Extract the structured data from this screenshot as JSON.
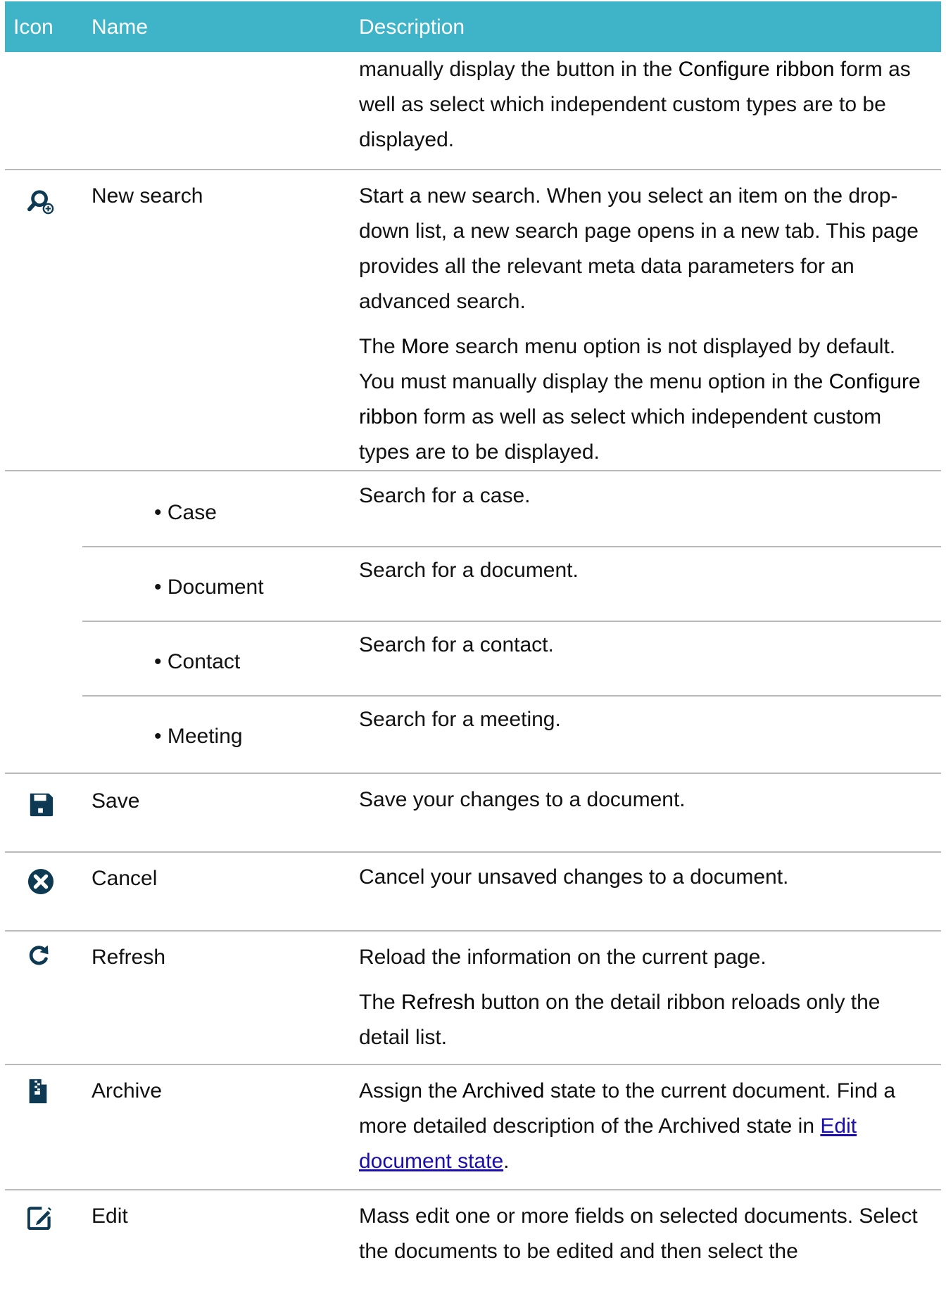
{
  "header": {
    "icon": "Icon",
    "name": "Name",
    "description": "Description"
  },
  "row0": {
    "desc_prefix": "manually display the button in the ",
    "desc_bold": "Configure ribbon",
    "desc_suffix": " form as well as select which independent custom types are to be displayed."
  },
  "new_search": {
    "icon": "search-plus-icon",
    "name": "New search",
    "desc1": "Start a new search. When you select an item on the drop-down list, a new search page opens in a new tab. This page provides all the relevant meta data parameters for an advanced search.",
    "desc2_a": "The ",
    "desc2_b": "More",
    "desc2_c": " search menu option is not displayed by default. You must manually display the menu option in the ",
    "desc2_d": "Configure ribbon",
    "desc2_e": " form as well as select which independent custom types are to be displayed."
  },
  "sub_items": [
    {
      "name": "Case",
      "desc": "Search for a case."
    },
    {
      "name": "Document",
      "desc": "Search for a document."
    },
    {
      "name": "Contact",
      "desc": "Search for a contact."
    },
    {
      "name": "Meeting",
      "desc": "Search for a meeting."
    }
  ],
  "save": {
    "icon": "floppy-disk-icon",
    "name": "Save",
    "desc": "Save your changes to a document."
  },
  "cancel": {
    "icon": "close-circle-icon",
    "name": "Cancel",
    "desc": "Cancel your unsaved changes to a document."
  },
  "refresh": {
    "icon": "refresh-icon",
    "name": "Refresh",
    "desc1": "Reload the information on the current page.",
    "desc2_a": "The ",
    "desc2_b": "Refresh",
    "desc2_c": " button on the detail ribbon reloads only the detail list."
  },
  "archive": {
    "icon": "archive-file-icon",
    "name": "Archive",
    "desc_a": "Assign the ",
    "desc_b": "Archived",
    "desc_c": " state to the current document. Find a more detailed description of the Archived state in ",
    "desc_link": "Edit document state",
    "desc_d": "."
  },
  "edit": {
    "icon": "edit-icon",
    "name": "Edit",
    "desc": "Mass edit one or more fields on selected documents. Select the documents to be edited and then select the"
  }
}
